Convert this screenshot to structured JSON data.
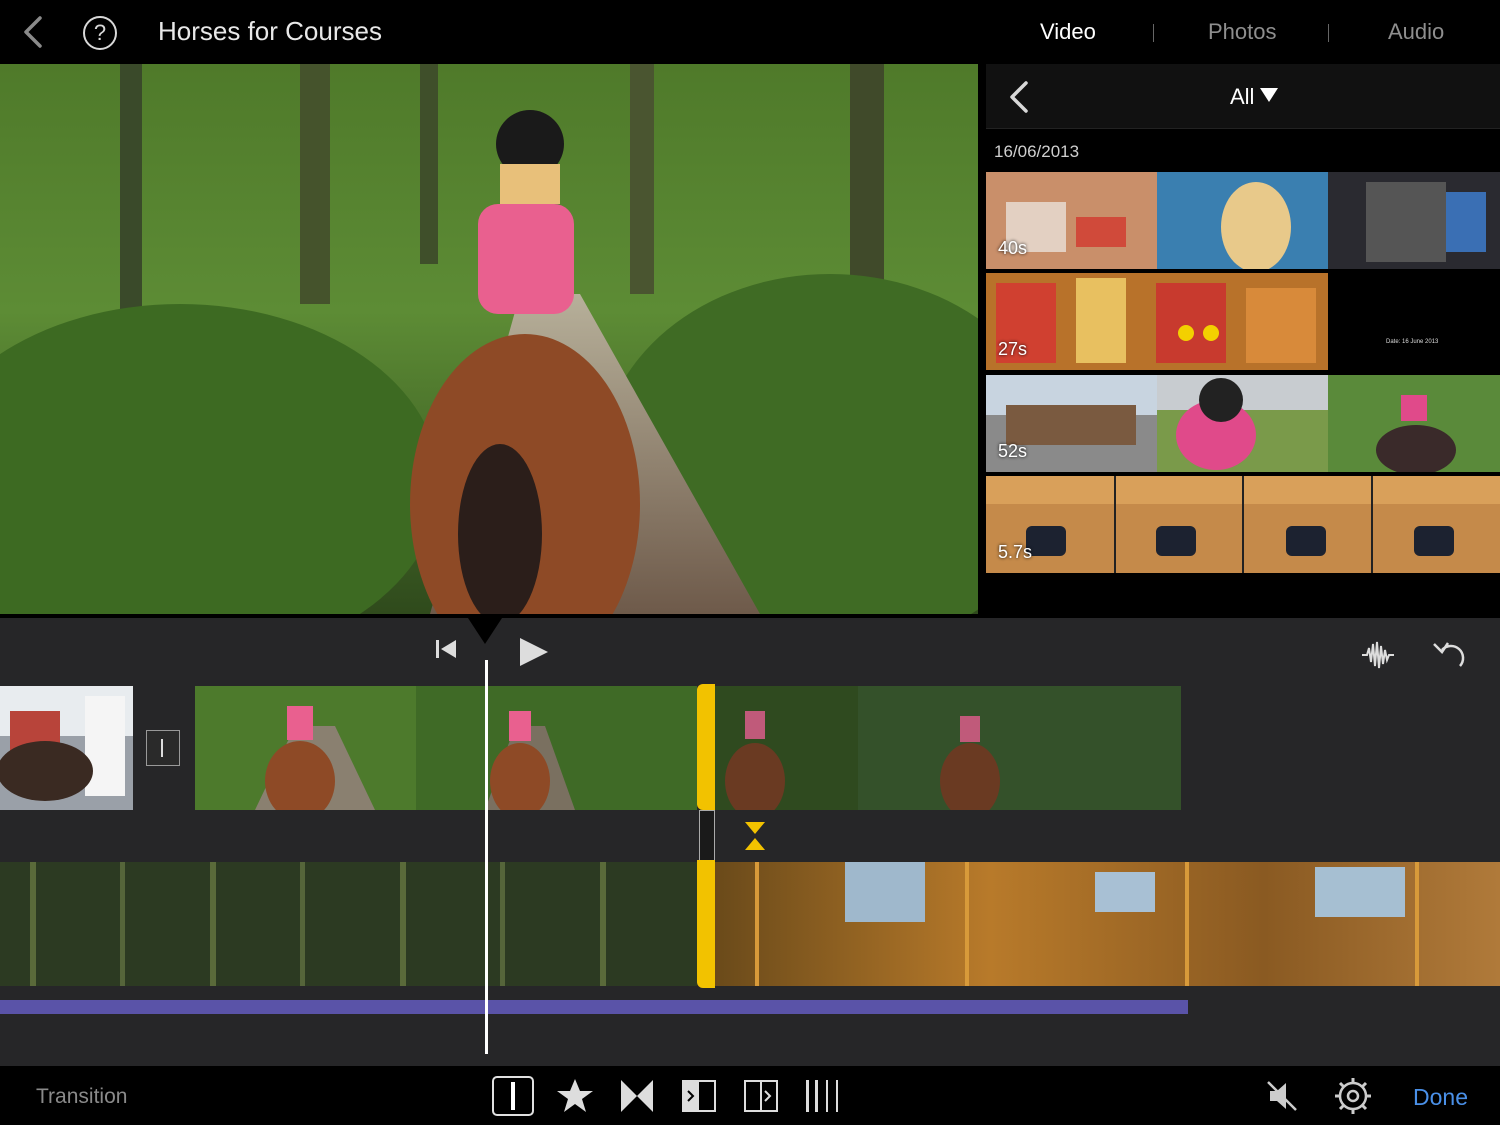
{
  "header": {
    "title": "Horses for Courses",
    "help_glyph": "?",
    "tabs": [
      {
        "label": "Video",
        "active": true
      },
      {
        "label": "Photos",
        "active": false
      },
      {
        "label": "Audio",
        "active": false
      }
    ]
  },
  "browser": {
    "filter_label": "All",
    "date": "16/06/2013",
    "clips": [
      {
        "duration": "40s"
      },
      {
        "duration": "27s",
        "title_card": "Date: 16 June 2013"
      },
      {
        "duration": "52s"
      },
      {
        "duration": "5.7s"
      }
    ]
  },
  "toolbar": {
    "mode_label": "Transition",
    "done_label": "Done"
  },
  "colors": {
    "accent": "#4a90e8",
    "trim_handle": "#f2c200",
    "audio_track": "#5a53a8"
  },
  "icons": {
    "back": "chevron-left-icon",
    "help": "help-icon",
    "skip_start": "skip-to-start-icon",
    "play": "play-icon",
    "waveform": "waveform-icon",
    "undo": "undo-icon",
    "mute": "mute-icon",
    "settings": "gear-icon"
  }
}
